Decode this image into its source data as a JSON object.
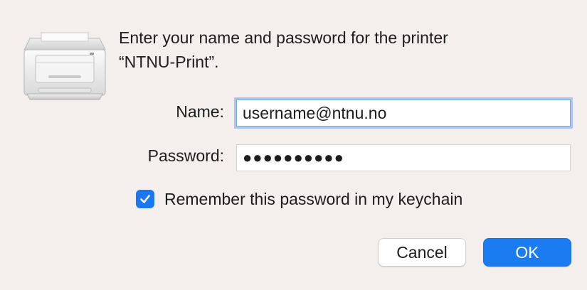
{
  "icon": "printer-icon",
  "message": {
    "line1": "Enter your name and password for the printer",
    "line2": "“NTNU-Print”."
  },
  "form": {
    "name_label": "Name:",
    "name_value": "username@ntnu.no",
    "password_label": "Password:",
    "password_masked": "●●●●●●●●●●",
    "remember_checked": true,
    "remember_label": "Remember this password in my keychain"
  },
  "buttons": {
    "cancel_label": "Cancel",
    "ok_label": "OK"
  },
  "colors": {
    "background": "#f4efed",
    "accent": "#1b7cf2",
    "focus_ring": "#a9c6f5"
  }
}
